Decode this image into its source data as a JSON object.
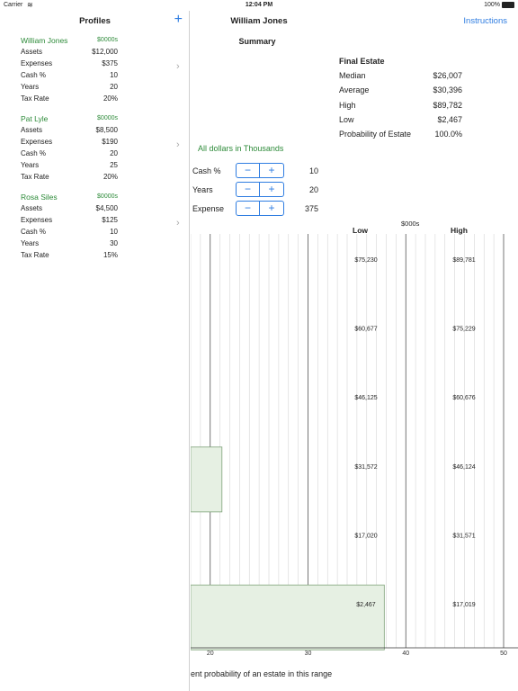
{
  "status": {
    "carrier": "Carrier",
    "time": "12:04 PM",
    "battery": "100%"
  },
  "sidebar": {
    "title": "Profiles",
    "add_symbol": "+",
    "profiles": [
      {
        "name": "William Jones",
        "unit": "$0000s",
        "rows": [
          {
            "label": "Assets",
            "value": "$12,000"
          },
          {
            "label": "Expenses",
            "value": "$375"
          },
          {
            "label": "Cash %",
            "value": "10"
          },
          {
            "label": "Years",
            "value": "20"
          },
          {
            "label": "Tax Rate",
            "value": "20%"
          }
        ]
      },
      {
        "name": "Pat Lyle",
        "unit": "$0000s",
        "rows": [
          {
            "label": "Assets",
            "value": "$8,500"
          },
          {
            "label": "Expenses",
            "value": "$190"
          },
          {
            "label": "Cash %",
            "value": "20"
          },
          {
            "label": "Years",
            "value": "25"
          },
          {
            "label": "Tax Rate",
            "value": "20%"
          }
        ]
      },
      {
        "name": "Rosa Siles",
        "unit": "$0000s",
        "rows": [
          {
            "label": "Assets",
            "value": "$4,500"
          },
          {
            "label": "Expenses",
            "value": "$125"
          },
          {
            "label": "Cash %",
            "value": "10"
          },
          {
            "label": "Years",
            "value": "30"
          },
          {
            "label": "Tax Rate",
            "value": "15%"
          }
        ]
      }
    ]
  },
  "main": {
    "nav_title": "William Jones",
    "instructions": "Instructions",
    "summary": "Summary",
    "final_estate": {
      "title": "Final Estate",
      "rows": [
        {
          "label": "Median",
          "value": "$26,007"
        },
        {
          "label": "Average",
          "value": "$30,396"
        },
        {
          "label": "High",
          "value": "$89,782"
        },
        {
          "label": "Low",
          "value": "$2,467"
        },
        {
          "label": "Probability of Estate",
          "value": "100.0%"
        }
      ]
    },
    "dollars_note": "All dollars in Thousands",
    "controls": [
      {
        "label": "Cash %",
        "value": "10"
      },
      {
        "label": "Years",
        "value": "20"
      },
      {
        "label": "Expense",
        "value": "375"
      }
    ],
    "stepper": {
      "minus": "−",
      "plus": "+"
    },
    "table_headers": {
      "low": "Low",
      "unit": "$000s",
      "high": "High"
    },
    "footnote": "ent probability of an estate in this range"
  },
  "chart_data": {
    "type": "bar",
    "orientation": "horizontal",
    "x_ticks": [
      20,
      30,
      40,
      50
    ],
    "x_visible_range": [
      18,
      50
    ],
    "grid": true,
    "ranges": [
      {
        "low": "$75,230",
        "high": "$89,781",
        "value": 0
      },
      {
        "low": "$60,677",
        "high": "$75,229",
        "value": 0
      },
      {
        "low": "$46,125",
        "high": "$60,676",
        "value": 0
      },
      {
        "low": "$31,572",
        "high": "$46,124",
        "value": 21.2
      },
      {
        "low": "$17,020",
        "high": "$31,571",
        "value": 0
      },
      {
        "low": "$2,467",
        "high": "$17,019",
        "value": 37.8
      }
    ],
    "bar_color": "#e6f0e3",
    "bar_stroke": "#7fa37a"
  }
}
